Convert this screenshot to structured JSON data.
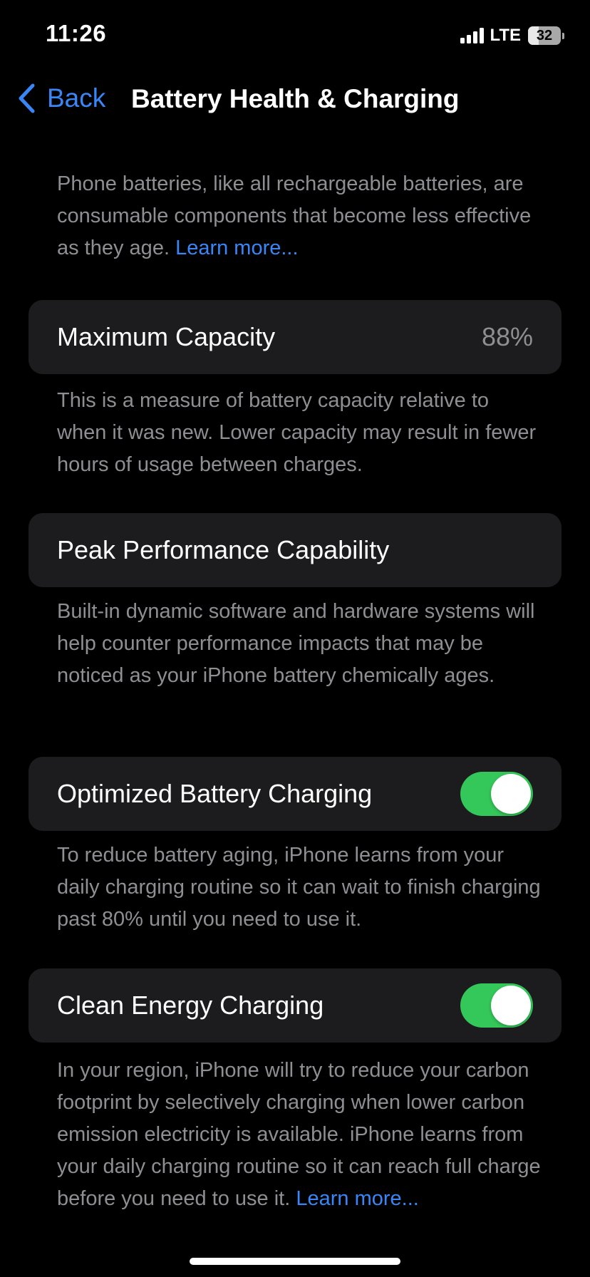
{
  "status_bar": {
    "time": "11:26",
    "network": "LTE",
    "battery_level": "32",
    "battery_fraction": 0.32
  },
  "nav": {
    "back_label": "Back",
    "title": "Battery Health & Charging"
  },
  "intro": {
    "text": "Phone batteries, like all rechargeable batteries, are consumable components that become less effective as they age. ",
    "link": "Learn more..."
  },
  "maximum_capacity": {
    "label": "Maximum Capacity",
    "value": "88%",
    "description": "This is a measure of battery capacity relative to when it was new. Lower capacity may result in fewer hours of usage between charges."
  },
  "peak_performance": {
    "label": "Peak Performance Capability",
    "description": "Built-in dynamic software and hardware systems will help counter performance impacts that may be noticed as your iPhone battery chemically ages."
  },
  "optimized_charging": {
    "label": "Optimized Battery Charging",
    "enabled": true,
    "description": "To reduce battery aging, iPhone learns from your daily charging routine so it can wait to finish charging past 80% until you need to use it."
  },
  "clean_energy": {
    "label": "Clean Energy Charging",
    "enabled": true,
    "description": "In your region, iPhone will try to reduce your carbon footprint by selectively charging when lower carbon emission electricity is available. iPhone learns from your daily charging routine so it can reach full charge before you need to use it. ",
    "link": "Learn more..."
  },
  "colors": {
    "accent": "#3a86f7",
    "toggle_on": "#34c759",
    "card_background": "#1c1c1e",
    "secondary_text": "#8e8e93"
  }
}
